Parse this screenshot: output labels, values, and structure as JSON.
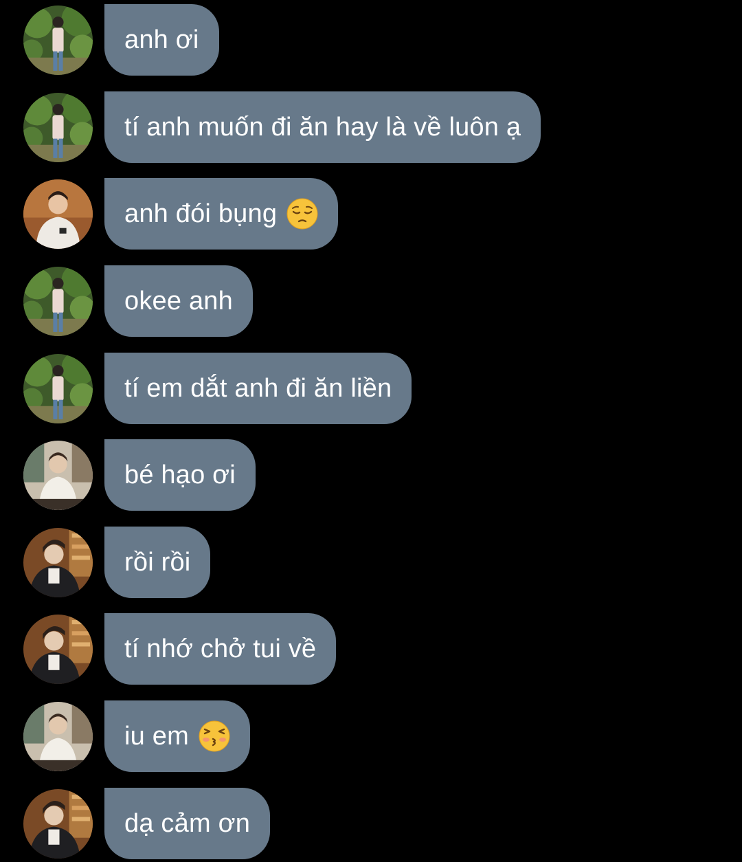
{
  "colors": {
    "background": "#000000",
    "bubble": "#67798a",
    "text": "#ffffff"
  },
  "messages": [
    {
      "text": "anh ơi",
      "avatar": "avatar-garden-icon",
      "emoji": null
    },
    {
      "text": "tí anh muốn đi ăn hay là về luôn ạ",
      "avatar": "avatar-garden-icon",
      "emoji": null
    },
    {
      "text": "anh đói bụng",
      "avatar": "avatar-warm-icon",
      "emoji": "pensive-face-icon"
    },
    {
      "text": "okee anh",
      "avatar": "avatar-garden-icon",
      "emoji": null
    },
    {
      "text": "tí em dắt anh đi ăn liền",
      "avatar": "avatar-garden-icon",
      "emoji": null
    },
    {
      "text": "bé hạo ơi",
      "avatar": "avatar-cafe-icon",
      "emoji": null
    },
    {
      "text": "rồi rồi",
      "avatar": "avatar-library-icon",
      "emoji": null
    },
    {
      "text": "tí nhớ chở tui về",
      "avatar": "avatar-library-icon",
      "emoji": null
    },
    {
      "text": "iu em",
      "avatar": "avatar-cafe-icon",
      "emoji": "kissing-face-icon"
    },
    {
      "text": "dạ cảm ơn",
      "avatar": "avatar-library-icon",
      "emoji": null
    }
  ]
}
